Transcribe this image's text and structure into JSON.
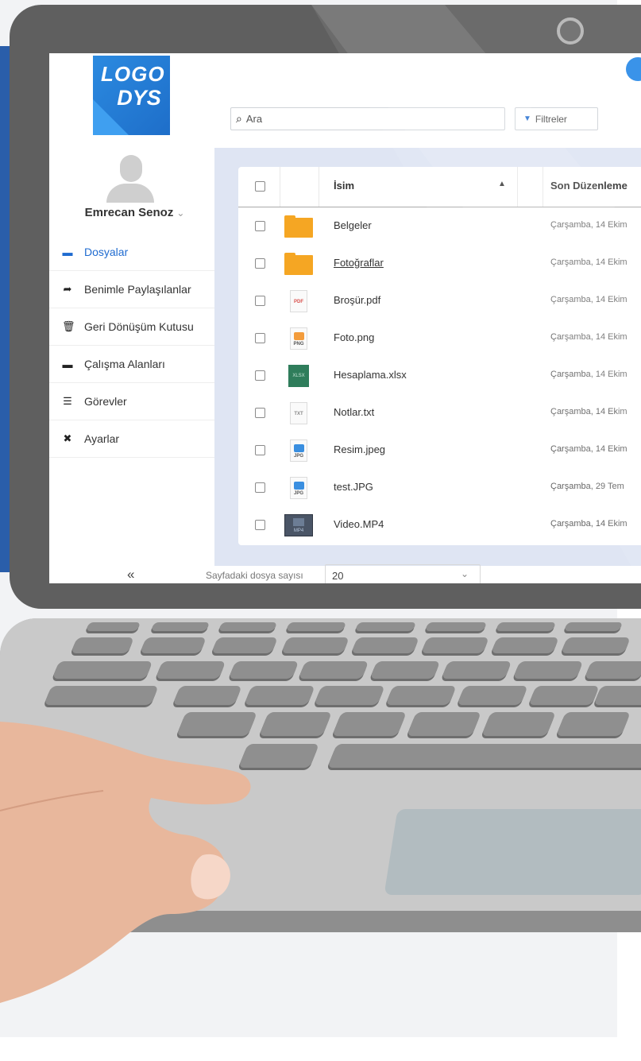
{
  "app": {
    "logo_top": "LOGO",
    "logo_bottom": "DYS"
  },
  "user": {
    "name": "Emrecan Senoz",
    "menu_caret": "⌄"
  },
  "sidebar": {
    "items": [
      {
        "label": "Dosyalar",
        "icon": "folder-icon",
        "glyph": "▬",
        "active": true
      },
      {
        "label": "Benimle Paylaşılanlar",
        "icon": "share-icon",
        "glyph": "➦",
        "active": false
      },
      {
        "label": "Geri Dönüşüm Kutusu",
        "icon": "trash-icon",
        "glyph": "🗑",
        "active": false
      },
      {
        "label": "Çalışma Alanları",
        "icon": "workspace-folder-icon",
        "glyph": "▬",
        "active": false
      },
      {
        "label": "Görevler",
        "icon": "list-icon",
        "glyph": "☰",
        "active": false
      },
      {
        "label": "Ayarlar",
        "icon": "tools-icon",
        "glyph": "✖",
        "active": false
      }
    ],
    "collapse_glyph": "«"
  },
  "search": {
    "placeholder": "Ara",
    "icon_glyph": "⌕"
  },
  "filters": {
    "label": "Filtreler",
    "icon_glyph": "▼"
  },
  "table": {
    "columns": {
      "name": "İsim",
      "modified": "Son Düzenleme"
    },
    "sort_glyph": "▲",
    "rows": [
      {
        "name": "Belgeler",
        "type": "folder",
        "date": "Çarşamba, 14 Ekim",
        "link": false
      },
      {
        "name": "Fotoğraflar",
        "type": "folder",
        "date": "Çarşamba, 14 Ekim",
        "link": true
      },
      {
        "name": "Broşür.pdf",
        "type": "pdf",
        "date": "Çarşamba, 14 Ekim",
        "link": false
      },
      {
        "name": "Foto.png",
        "type": "png",
        "date": "Çarşamba, 14 Ekim",
        "link": false
      },
      {
        "name": "Hesaplama.xlsx",
        "type": "xlsx",
        "date": "Çarşamba, 14 Ekim",
        "link": false
      },
      {
        "name": "Notlar.txt",
        "type": "txt",
        "date": "Çarşamba, 14 Ekim",
        "link": false
      },
      {
        "name": "Resim.jpeg",
        "type": "jpg",
        "date": "Çarşamba, 14 Ekim",
        "link": false
      },
      {
        "name": "test.JPG",
        "type": "jpg",
        "date": "Çarşamba, 29 Tem",
        "link": false
      },
      {
        "name": "Video.MP4",
        "type": "mp4",
        "date": "Çarşamba, 14 Ekim",
        "link": false
      }
    ],
    "file_type_labels": {
      "pdf": "PDF",
      "png": "PNG",
      "xlsx": "XLSX",
      "txt": "TXT",
      "jpg": "JPG",
      "mp4": "MP4"
    }
  },
  "footer": {
    "per_page_label": "Sayfadaki dosya sayısı",
    "per_page_value": "20",
    "arrow_glyph": "⌄"
  },
  "colors": {
    "accent_blue": "#1f6bd0",
    "brand_panel": "#2a5eaa",
    "folder": "#f5a623",
    "xlsx_green": "#2f7d5b",
    "content_bg": "#dfe5f3"
  }
}
